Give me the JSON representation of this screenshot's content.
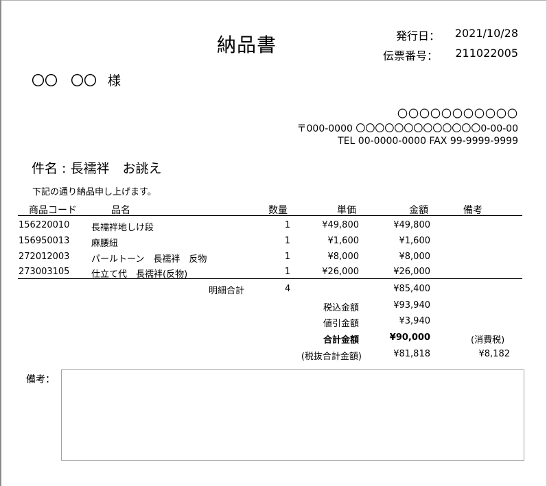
{
  "document": {
    "title": "納品書",
    "issue_date_label": "発行日：",
    "issue_date": "2021/10/28",
    "slip_no_label": "伝票番号：",
    "slip_no": "211022005",
    "customer_name": "〇〇　〇〇",
    "customer_suffix": "様"
  },
  "company": {
    "name": "〇〇〇〇〇〇〇〇〇〇〇",
    "address": "〒000-0000 〇〇〇〇〇〇〇〇〇〇〇〇〇0-00-00",
    "tel_fax": "TEL 00-0000-0000  FAX 99-9999-9999"
  },
  "subject": "件名 : 長襦袢　お誂え",
  "lead_text": "下記の通り納品申し上げます。",
  "table": {
    "headers": {
      "code": "商品コード",
      "name": "品名",
      "qty": "数量",
      "unit_price": "単価",
      "amount": "金額",
      "remarks": "備考"
    },
    "rows": [
      {
        "code": "156220010",
        "name": "長襦袢地しけ段",
        "qty": "1",
        "unit_price": "¥49,800",
        "amount": "¥49,800"
      },
      {
        "code": "156950013",
        "name": "麻腰紐",
        "qty": "1",
        "unit_price": "¥1,600",
        "amount": "¥1,600"
      },
      {
        "code": "272012003",
        "name": "パールトーン　長襦袢　反物",
        "qty": "1",
        "unit_price": "¥8,000",
        "amount": "¥8,000"
      },
      {
        "code": "273003105",
        "name": "仕立て代　長襦袢(反物)",
        "qty": "1",
        "unit_price": "¥26,000",
        "amount": "¥26,000"
      }
    ]
  },
  "totals": {
    "detail_total_label": "明細合計",
    "detail_total_qty": "4",
    "detail_total_amount": "¥85,400",
    "tax_included_label": "税込金額",
    "tax_included_amount": "¥93,940",
    "discount_label": "値引金額",
    "discount_amount": "¥3,940",
    "grand_total_label": "合計金額",
    "grand_total_amount": "¥90,000",
    "consumption_tax_label": "(消費税)",
    "pre_tax_label": "(税抜合計金額)",
    "pre_tax_amount": "¥81,818",
    "consumption_tax_amount": "¥8,182"
  },
  "notes": {
    "label": "備考：",
    "content": ""
  }
}
